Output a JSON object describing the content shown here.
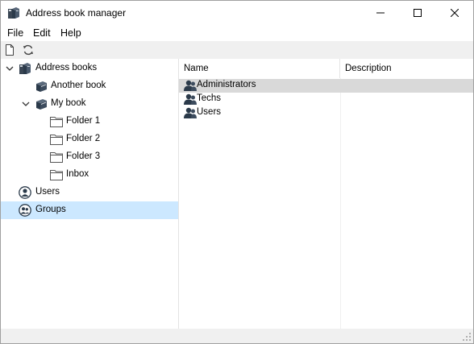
{
  "window": {
    "title": "Address book manager",
    "app_icon": "address-books-icon"
  },
  "menu": {
    "file": "File",
    "edit": "Edit",
    "help": "Help"
  },
  "toolbar": {
    "buttons": [
      "new-document-icon",
      "refresh-icon"
    ]
  },
  "tree": {
    "items": [
      {
        "label": "Address books",
        "icon": "address-books-icon",
        "expanded": true
      },
      {
        "label": "Another book",
        "icon": "book-icon"
      },
      {
        "label": "My book",
        "icon": "book-icon",
        "expanded": true
      },
      {
        "label": "Folder 1",
        "icon": "folder-icon"
      },
      {
        "label": "Folder 2",
        "icon": "folder-icon"
      },
      {
        "label": "Folder 3",
        "icon": "folder-icon"
      },
      {
        "label": "Inbox",
        "icon": "folder-icon"
      },
      {
        "label": "Users",
        "icon": "user-icon"
      },
      {
        "label": "Groups",
        "icon": "group-icon",
        "selected": true
      }
    ]
  },
  "list": {
    "columns": [
      "Name",
      "Description"
    ],
    "rows": [
      {
        "name": "Administrators",
        "description": "",
        "icon": "group-icon",
        "selected": true
      },
      {
        "name": "Techs",
        "description": "",
        "icon": "group-icon"
      },
      {
        "name": "Users",
        "description": "",
        "icon": "group-icon"
      }
    ]
  },
  "colors": {
    "tree_selection": "#cce8ff",
    "list_selection": "#d9d9d9",
    "toolbar_bg": "#f0f0f0",
    "icon_dark": "#2b3a4a"
  }
}
